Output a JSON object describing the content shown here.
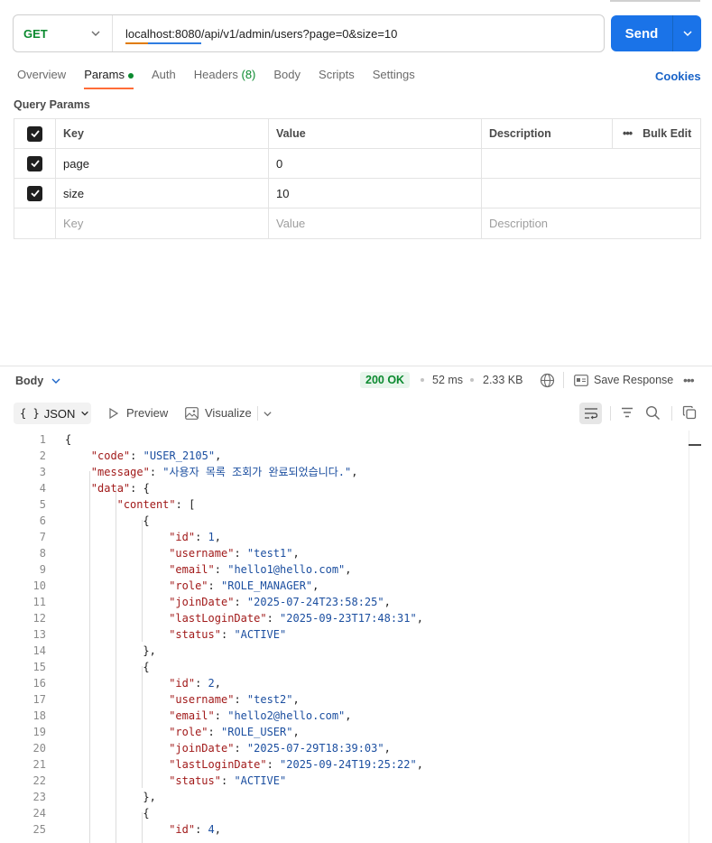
{
  "request": {
    "method": "GET",
    "url": "localhost:8080/api/v1/admin/users?page=0&size=10",
    "send_label": "Send"
  },
  "tabs": {
    "overview": "Overview",
    "params": "Params",
    "auth": "Auth",
    "headers": "Headers",
    "headers_count": "(8)",
    "body": "Body",
    "scripts": "Scripts",
    "settings": "Settings",
    "cookies": "Cookies"
  },
  "query_params": {
    "title": "Query Params",
    "headers": {
      "key": "Key",
      "value": "Value",
      "description": "Description",
      "bulk_edit": "Bulk Edit"
    },
    "rows": [
      {
        "key": "page",
        "value": "0",
        "description": ""
      },
      {
        "key": "size",
        "value": "10",
        "description": ""
      }
    ],
    "placeholders": {
      "key": "Key",
      "value": "Value",
      "description": "Description"
    }
  },
  "response": {
    "body_label": "Body",
    "status": "200 OK",
    "time": "52 ms",
    "size": "2.33 KB",
    "save_label": "Save Response",
    "format": "JSON",
    "format_icon": "{ }",
    "preview_label": "Preview",
    "visualize_label": "Visualize"
  },
  "code_lines": [
    {
      "n": "1",
      "indent": 0,
      "parts": [
        [
          "p",
          "{"
        ]
      ]
    },
    {
      "n": "2",
      "indent": 1,
      "parts": [
        [
          "k",
          "\"code\""
        ],
        [
          "p",
          ": "
        ],
        [
          "s",
          "\"USER_2105\""
        ],
        [
          "p",
          ","
        ]
      ]
    },
    {
      "n": "3",
      "indent": 1,
      "parts": [
        [
          "k",
          "\"message\""
        ],
        [
          "p",
          ": "
        ],
        [
          "s",
          "\"사용자 목록 조회가 완료되었습니다.\""
        ],
        [
          "p",
          ","
        ]
      ]
    },
    {
      "n": "4",
      "indent": 1,
      "parts": [
        [
          "k",
          "\"data\""
        ],
        [
          "p",
          ": {"
        ]
      ]
    },
    {
      "n": "5",
      "indent": 2,
      "parts": [
        [
          "k",
          "\"content\""
        ],
        [
          "p",
          ": ["
        ]
      ]
    },
    {
      "n": "6",
      "indent": 3,
      "parts": [
        [
          "p",
          "{"
        ]
      ]
    },
    {
      "n": "7",
      "indent": 4,
      "parts": [
        [
          "k",
          "\"id\""
        ],
        [
          "p",
          ": "
        ],
        [
          "s",
          "1"
        ],
        [
          "p",
          ","
        ]
      ]
    },
    {
      "n": "8",
      "indent": 4,
      "parts": [
        [
          "k",
          "\"username\""
        ],
        [
          "p",
          ": "
        ],
        [
          "s",
          "\"test1\""
        ],
        [
          "p",
          ","
        ]
      ]
    },
    {
      "n": "9",
      "indent": 4,
      "parts": [
        [
          "k",
          "\"email\""
        ],
        [
          "p",
          ": "
        ],
        [
          "s",
          "\"hello1@hello.com\""
        ],
        [
          "p",
          ","
        ]
      ]
    },
    {
      "n": "10",
      "indent": 4,
      "parts": [
        [
          "k",
          "\"role\""
        ],
        [
          "p",
          ": "
        ],
        [
          "s",
          "\"ROLE_MANAGER\""
        ],
        [
          "p",
          ","
        ]
      ]
    },
    {
      "n": "11",
      "indent": 4,
      "parts": [
        [
          "k",
          "\"joinDate\""
        ],
        [
          "p",
          ": "
        ],
        [
          "s",
          "\"2025-07-24T23:58:25\""
        ],
        [
          "p",
          ","
        ]
      ]
    },
    {
      "n": "12",
      "indent": 4,
      "parts": [
        [
          "k",
          "\"lastLoginDate\""
        ],
        [
          "p",
          ": "
        ],
        [
          "s",
          "\"2025-09-23T17:48:31\""
        ],
        [
          "p",
          ","
        ]
      ]
    },
    {
      "n": "13",
      "indent": 4,
      "parts": [
        [
          "k",
          "\"status\""
        ],
        [
          "p",
          ": "
        ],
        [
          "s",
          "\"ACTIVE\""
        ]
      ]
    },
    {
      "n": "14",
      "indent": 3,
      "parts": [
        [
          "p",
          "},"
        ]
      ]
    },
    {
      "n": "15",
      "indent": 3,
      "parts": [
        [
          "p",
          "{"
        ]
      ]
    },
    {
      "n": "16",
      "indent": 4,
      "parts": [
        [
          "k",
          "\"id\""
        ],
        [
          "p",
          ": "
        ],
        [
          "s",
          "2"
        ],
        [
          "p",
          ","
        ]
      ]
    },
    {
      "n": "17",
      "indent": 4,
      "parts": [
        [
          "k",
          "\"username\""
        ],
        [
          "p",
          ": "
        ],
        [
          "s",
          "\"test2\""
        ],
        [
          "p",
          ","
        ]
      ]
    },
    {
      "n": "18",
      "indent": 4,
      "parts": [
        [
          "k",
          "\"email\""
        ],
        [
          "p",
          ": "
        ],
        [
          "s",
          "\"hello2@hello.com\""
        ],
        [
          "p",
          ","
        ]
      ]
    },
    {
      "n": "19",
      "indent": 4,
      "parts": [
        [
          "k",
          "\"role\""
        ],
        [
          "p",
          ": "
        ],
        [
          "s",
          "\"ROLE_USER\""
        ],
        [
          "p",
          ","
        ]
      ]
    },
    {
      "n": "20",
      "indent": 4,
      "parts": [
        [
          "k",
          "\"joinDate\""
        ],
        [
          "p",
          ": "
        ],
        [
          "s",
          "\"2025-07-29T18:39:03\""
        ],
        [
          "p",
          ","
        ]
      ]
    },
    {
      "n": "21",
      "indent": 4,
      "parts": [
        [
          "k",
          "\"lastLoginDate\""
        ],
        [
          "p",
          ": "
        ],
        [
          "s",
          "\"2025-09-24T19:25:22\""
        ],
        [
          "p",
          ","
        ]
      ]
    },
    {
      "n": "22",
      "indent": 4,
      "parts": [
        [
          "k",
          "\"status\""
        ],
        [
          "p",
          ": "
        ],
        [
          "s",
          "\"ACTIVE\""
        ]
      ]
    },
    {
      "n": "23",
      "indent": 3,
      "parts": [
        [
          "p",
          "},"
        ]
      ]
    },
    {
      "n": "24",
      "indent": 3,
      "parts": [
        [
          "p",
          "{"
        ]
      ]
    },
    {
      "n": "25",
      "indent": 4,
      "parts": [
        [
          "k",
          "\"id\""
        ],
        [
          "p",
          ": "
        ],
        [
          "s",
          "4"
        ],
        [
          "p",
          ","
        ]
      ]
    }
  ],
  "icons": {
    "chevron": "chevron-down-icon",
    "check": "check-icon",
    "more": "more-icon",
    "globe": "globe-icon",
    "save": "save-response-icon",
    "play": "play-icon",
    "image": "image-icon",
    "wrap": "wrap-lines-icon",
    "filter": "filter-icon",
    "search": "search-icon",
    "copy": "copy-icon"
  },
  "colors": {
    "send": "#1a73e8",
    "method": "#0b8a2f",
    "active_tab": "#ff6c37",
    "status_bg": "#e8f5ec",
    "json_key": "#a11a1a",
    "json_value": "#1c4fa0"
  }
}
